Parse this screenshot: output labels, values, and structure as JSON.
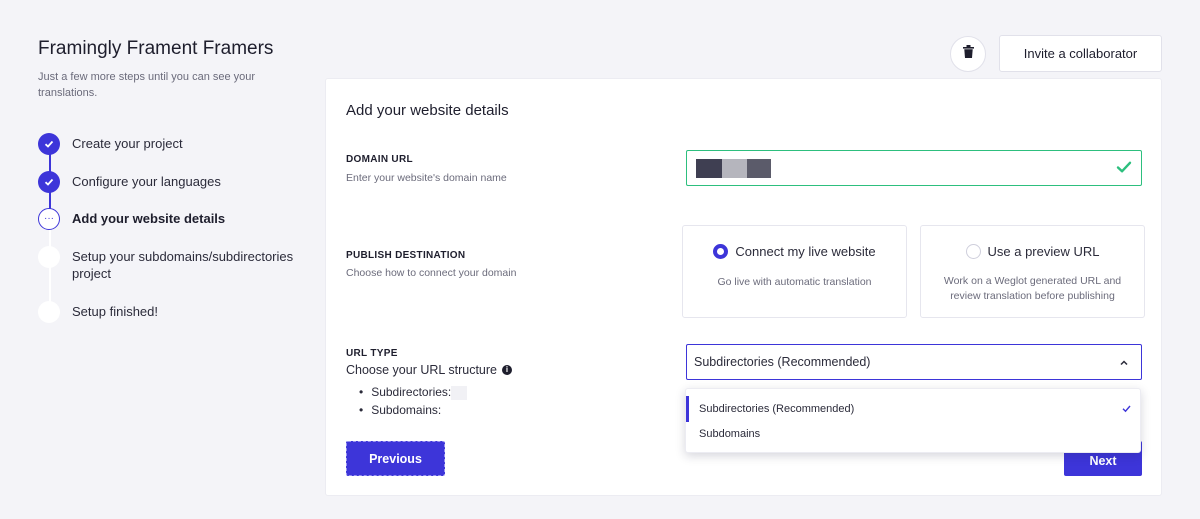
{
  "sidebar": {
    "project_title": "Framingly Frament Framers",
    "subtitle": "Just a few more steps until you can see your translations.",
    "steps": [
      {
        "label": "Create your project",
        "state": "done"
      },
      {
        "label": "Configure your languages",
        "state": "done"
      },
      {
        "label": "Add your website details",
        "state": "current"
      },
      {
        "label": "Setup your subdomains/subdirectories project",
        "state": "todo"
      },
      {
        "label": "Setup finished!",
        "state": "todo"
      }
    ],
    "current_marker": "···"
  },
  "header": {
    "delete_icon": "trash-icon",
    "invite_label": "Invite a collaborator"
  },
  "card": {
    "title": "Add your website details",
    "domain": {
      "label": "DOMAIN URL",
      "description": "Enter your website's domain name",
      "status_icon": "check-icon",
      "status_color": "#2dbf7e"
    },
    "publish": {
      "label": "PUBLISH DESTINATION",
      "description": "Choose how to connect your domain",
      "options": [
        {
          "label": "Connect my live website",
          "description": "Go live with automatic translation",
          "selected": true
        },
        {
          "label": "Use a preview URL",
          "description": "Work on a Weglot generated URL and review translation before publishing",
          "selected": false
        }
      ]
    },
    "url_type": {
      "label": "URL TYPE",
      "description": "Choose your URL structure",
      "info_icon": "i",
      "list": [
        "Subdirectories:",
        "Subdomains:"
      ],
      "selected_value": "Subdirectories (Recommended)",
      "options": [
        "Subdirectories (Recommended)",
        "Subdomains"
      ]
    },
    "previous_label": "Previous",
    "next_label": "Next"
  },
  "colors": {
    "accent": "#3d35d9",
    "success": "#2dbf7e",
    "background": "#f4f4f8"
  }
}
